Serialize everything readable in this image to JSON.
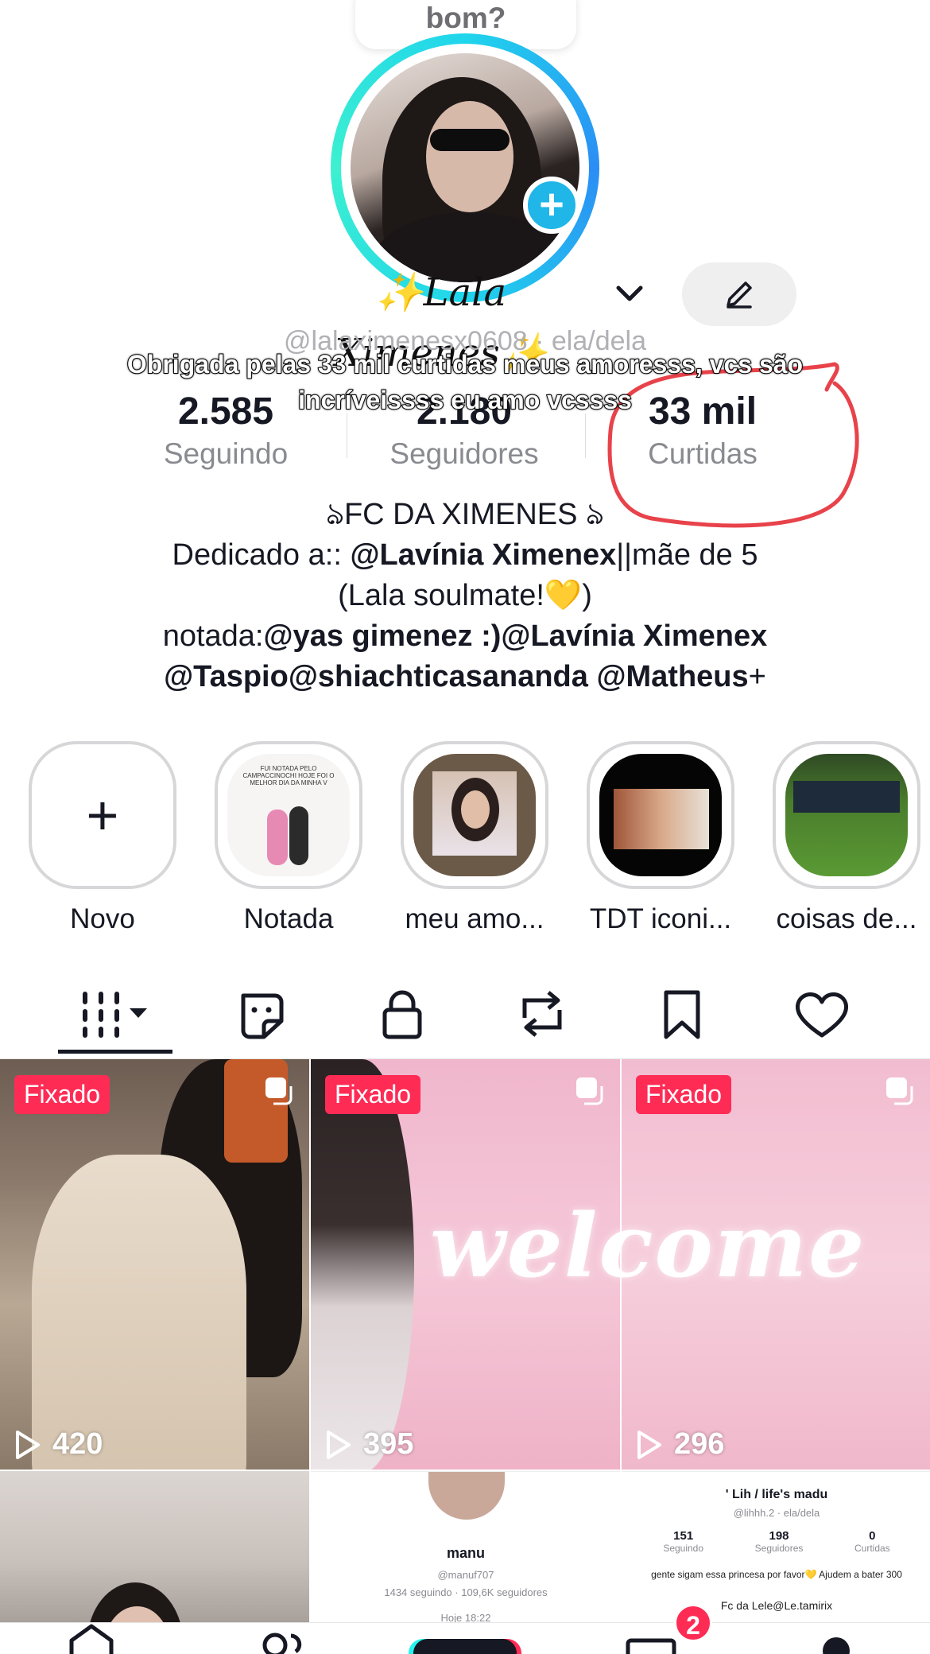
{
  "bubble": {
    "text": "bom?"
  },
  "profile": {
    "name": "✨Lala Ximenes✨",
    "handle": "@lalaximenesx0608 · ela/dela",
    "overlay_caption": "Obrigada pelas 33 mil curtidas meus amoresss, vcs são incríveissss eu amo vcssss"
  },
  "stats": [
    {
      "value": "2.585",
      "label": "Seguindo"
    },
    {
      "value": "2.180",
      "label": "Seguidores"
    },
    {
      "value": "33 mil",
      "label": "Curtidas"
    }
  ],
  "bio": {
    "line1": "ঌFC DA XIMENES ঌ",
    "line2_prefix": "Dedicado a:: ",
    "line2_bold": "@Lavínia Ximenex",
    "line2_suffix": "||mãe de 5",
    "line3": "(Lala soulmate!💛)",
    "line4_prefix": "notada:",
    "line4_bold": "@yas gimenez :)@Lavínia Ximenex",
    "line5_bold": "@Taspio@shiachticasananda @Matheus",
    "line5_suffix": "+"
  },
  "highlights": [
    {
      "label": "Novo"
    },
    {
      "label": "Notada",
      "caption": "FUI NOTADA PELO CAMPACCINOCHI HOJE FOI O MELHOR DIA DA MINHA V"
    },
    {
      "label": "meu amo..."
    },
    {
      "label": "TDT iconi..."
    },
    {
      "label": "coisas de..."
    }
  ],
  "tabs": [
    {
      "name": "videos"
    },
    {
      "name": "stickers"
    },
    {
      "name": "private"
    },
    {
      "name": "reposts"
    },
    {
      "name": "saved"
    },
    {
      "name": "liked"
    }
  ],
  "grid": {
    "pinned_label": "Fixado",
    "videos": [
      {
        "views": "420"
      },
      {
        "views": "395",
        "overlay": "welcome"
      },
      {
        "views": "296",
        "overlay": "welcome"
      }
    ],
    "preview_manu": {
      "name": "manu",
      "handle": "@manuf707",
      "stats": "1434 seguindo · 109,6K seguidores",
      "time": "Hoje 18:22"
    },
    "preview_lih": {
      "title": "' Lih / life's madu",
      "handle": "@lihhh.2 · ela/dela",
      "s1v": "151",
      "s1l": "Seguindo",
      "s2v": "198",
      "s2l": "Seguidores",
      "s3v": "0",
      "s3l": "Curtidas",
      "caption": "gente sigam essa princesa por favor💛 Ajudem a bater 300",
      "bio": "Fc da Lele@Le.tamirix"
    }
  },
  "nav": {
    "inbox_badge": "2"
  },
  "colors": {
    "accent": "#fe2c55",
    "ring": "#20d5ec",
    "text": "#161823",
    "muted": "#8a8b91",
    "annotation": "#e8424a"
  }
}
